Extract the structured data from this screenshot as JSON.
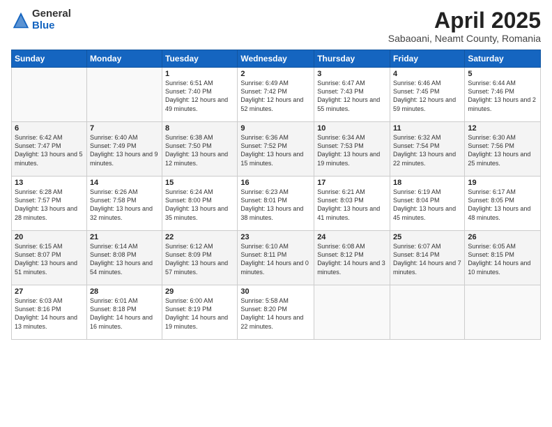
{
  "logo": {
    "general": "General",
    "blue": "Blue"
  },
  "title": "April 2025",
  "subtitle": "Sabaoani, Neamt County, Romania",
  "days_header": [
    "Sunday",
    "Monday",
    "Tuesday",
    "Wednesday",
    "Thursday",
    "Friday",
    "Saturday"
  ],
  "weeks": [
    [
      {
        "day": "",
        "sunrise": "",
        "sunset": "",
        "daylight": ""
      },
      {
        "day": "",
        "sunrise": "",
        "sunset": "",
        "daylight": ""
      },
      {
        "day": "1",
        "sunrise": "Sunrise: 6:51 AM",
        "sunset": "Sunset: 7:40 PM",
        "daylight": "Daylight: 12 hours and 49 minutes."
      },
      {
        "day": "2",
        "sunrise": "Sunrise: 6:49 AM",
        "sunset": "Sunset: 7:42 PM",
        "daylight": "Daylight: 12 hours and 52 minutes."
      },
      {
        "day": "3",
        "sunrise": "Sunrise: 6:47 AM",
        "sunset": "Sunset: 7:43 PM",
        "daylight": "Daylight: 12 hours and 55 minutes."
      },
      {
        "day": "4",
        "sunrise": "Sunrise: 6:46 AM",
        "sunset": "Sunset: 7:45 PM",
        "daylight": "Daylight: 12 hours and 59 minutes."
      },
      {
        "day": "5",
        "sunrise": "Sunrise: 6:44 AM",
        "sunset": "Sunset: 7:46 PM",
        "daylight": "Daylight: 13 hours and 2 minutes."
      }
    ],
    [
      {
        "day": "6",
        "sunrise": "Sunrise: 6:42 AM",
        "sunset": "Sunset: 7:47 PM",
        "daylight": "Daylight: 13 hours and 5 minutes."
      },
      {
        "day": "7",
        "sunrise": "Sunrise: 6:40 AM",
        "sunset": "Sunset: 7:49 PM",
        "daylight": "Daylight: 13 hours and 9 minutes."
      },
      {
        "day": "8",
        "sunrise": "Sunrise: 6:38 AM",
        "sunset": "Sunset: 7:50 PM",
        "daylight": "Daylight: 13 hours and 12 minutes."
      },
      {
        "day": "9",
        "sunrise": "Sunrise: 6:36 AM",
        "sunset": "Sunset: 7:52 PM",
        "daylight": "Daylight: 13 hours and 15 minutes."
      },
      {
        "day": "10",
        "sunrise": "Sunrise: 6:34 AM",
        "sunset": "Sunset: 7:53 PM",
        "daylight": "Daylight: 13 hours and 19 minutes."
      },
      {
        "day": "11",
        "sunrise": "Sunrise: 6:32 AM",
        "sunset": "Sunset: 7:54 PM",
        "daylight": "Daylight: 13 hours and 22 minutes."
      },
      {
        "day": "12",
        "sunrise": "Sunrise: 6:30 AM",
        "sunset": "Sunset: 7:56 PM",
        "daylight": "Daylight: 13 hours and 25 minutes."
      }
    ],
    [
      {
        "day": "13",
        "sunrise": "Sunrise: 6:28 AM",
        "sunset": "Sunset: 7:57 PM",
        "daylight": "Daylight: 13 hours and 28 minutes."
      },
      {
        "day": "14",
        "sunrise": "Sunrise: 6:26 AM",
        "sunset": "Sunset: 7:58 PM",
        "daylight": "Daylight: 13 hours and 32 minutes."
      },
      {
        "day": "15",
        "sunrise": "Sunrise: 6:24 AM",
        "sunset": "Sunset: 8:00 PM",
        "daylight": "Daylight: 13 hours and 35 minutes."
      },
      {
        "day": "16",
        "sunrise": "Sunrise: 6:23 AM",
        "sunset": "Sunset: 8:01 PM",
        "daylight": "Daylight: 13 hours and 38 minutes."
      },
      {
        "day": "17",
        "sunrise": "Sunrise: 6:21 AM",
        "sunset": "Sunset: 8:03 PM",
        "daylight": "Daylight: 13 hours and 41 minutes."
      },
      {
        "day": "18",
        "sunrise": "Sunrise: 6:19 AM",
        "sunset": "Sunset: 8:04 PM",
        "daylight": "Daylight: 13 hours and 45 minutes."
      },
      {
        "day": "19",
        "sunrise": "Sunrise: 6:17 AM",
        "sunset": "Sunset: 8:05 PM",
        "daylight": "Daylight: 13 hours and 48 minutes."
      }
    ],
    [
      {
        "day": "20",
        "sunrise": "Sunrise: 6:15 AM",
        "sunset": "Sunset: 8:07 PM",
        "daylight": "Daylight: 13 hours and 51 minutes."
      },
      {
        "day": "21",
        "sunrise": "Sunrise: 6:14 AM",
        "sunset": "Sunset: 8:08 PM",
        "daylight": "Daylight: 13 hours and 54 minutes."
      },
      {
        "day": "22",
        "sunrise": "Sunrise: 6:12 AM",
        "sunset": "Sunset: 8:09 PM",
        "daylight": "Daylight: 13 hours and 57 minutes."
      },
      {
        "day": "23",
        "sunrise": "Sunrise: 6:10 AM",
        "sunset": "Sunset: 8:11 PM",
        "daylight": "Daylight: 14 hours and 0 minutes."
      },
      {
        "day": "24",
        "sunrise": "Sunrise: 6:08 AM",
        "sunset": "Sunset: 8:12 PM",
        "daylight": "Daylight: 14 hours and 3 minutes."
      },
      {
        "day": "25",
        "sunrise": "Sunrise: 6:07 AM",
        "sunset": "Sunset: 8:14 PM",
        "daylight": "Daylight: 14 hours and 7 minutes."
      },
      {
        "day": "26",
        "sunrise": "Sunrise: 6:05 AM",
        "sunset": "Sunset: 8:15 PM",
        "daylight": "Daylight: 14 hours and 10 minutes."
      }
    ],
    [
      {
        "day": "27",
        "sunrise": "Sunrise: 6:03 AM",
        "sunset": "Sunset: 8:16 PM",
        "daylight": "Daylight: 14 hours and 13 minutes."
      },
      {
        "day": "28",
        "sunrise": "Sunrise: 6:01 AM",
        "sunset": "Sunset: 8:18 PM",
        "daylight": "Daylight: 14 hours and 16 minutes."
      },
      {
        "day": "29",
        "sunrise": "Sunrise: 6:00 AM",
        "sunset": "Sunset: 8:19 PM",
        "daylight": "Daylight: 14 hours and 19 minutes."
      },
      {
        "day": "30",
        "sunrise": "Sunrise: 5:58 AM",
        "sunset": "Sunset: 8:20 PM",
        "daylight": "Daylight: 14 hours and 22 minutes."
      },
      {
        "day": "",
        "sunrise": "",
        "sunset": "",
        "daylight": ""
      },
      {
        "day": "",
        "sunrise": "",
        "sunset": "",
        "daylight": ""
      },
      {
        "day": "",
        "sunrise": "",
        "sunset": "",
        "daylight": ""
      }
    ]
  ]
}
